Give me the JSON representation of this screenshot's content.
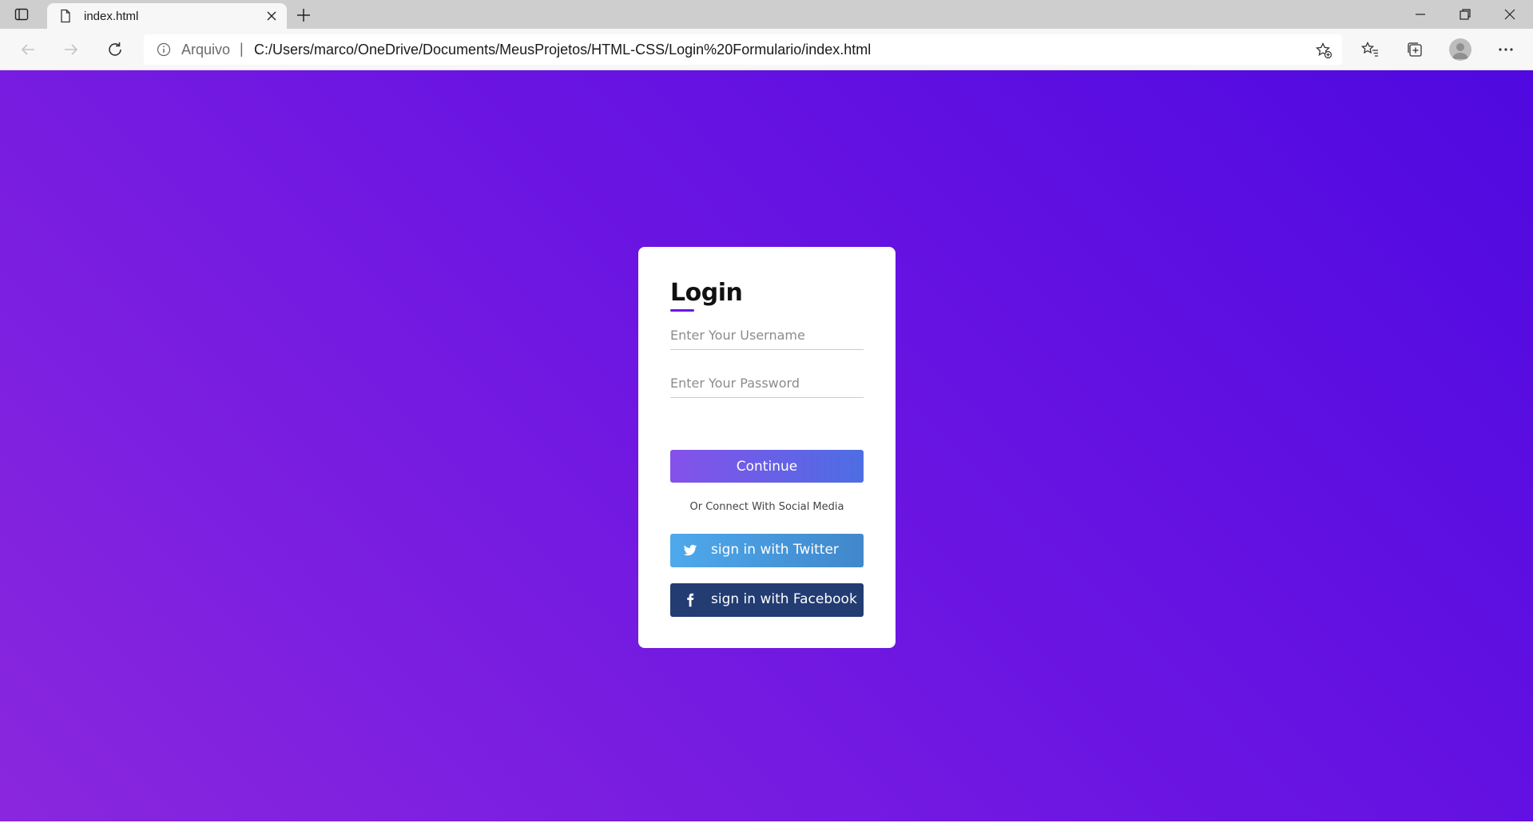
{
  "browser": {
    "tab": {
      "title": "index.html"
    },
    "address": {
      "scheme_label": "Arquivo",
      "separator": "|",
      "url": "C:/Users/marco/OneDrive/Documents/MeusProjetos/HTML-CSS/Login%20Formulario/index.html"
    }
  },
  "login": {
    "title": "Login",
    "username": {
      "placeholder": "Enter Your Username",
      "value": ""
    },
    "password": {
      "placeholder": "Enter Your Password",
      "value": ""
    },
    "continue_label": "Continue",
    "social_caption": "Or Connect With Social Media",
    "twitter_label": "sign in with Twitter",
    "facebook_label": "sign in with Facebook"
  },
  "colors": {
    "gradient_start": "#8a27de",
    "gradient_end": "#4f09e0",
    "accent": "#6a16e6",
    "twitter": "#4ea9ec",
    "facebook": "#233c72"
  },
  "icons": [
    "tab-actions-icon",
    "file-icon",
    "close-icon",
    "plus-icon",
    "minimize-icon",
    "restore-icon",
    "back-arrow-icon",
    "forward-arrow-icon",
    "refresh-icon",
    "info-icon",
    "add-favorite-icon",
    "favorites-icon",
    "collections-icon",
    "profile-icon",
    "more-icon",
    "twitter-icon",
    "facebook-icon"
  ]
}
